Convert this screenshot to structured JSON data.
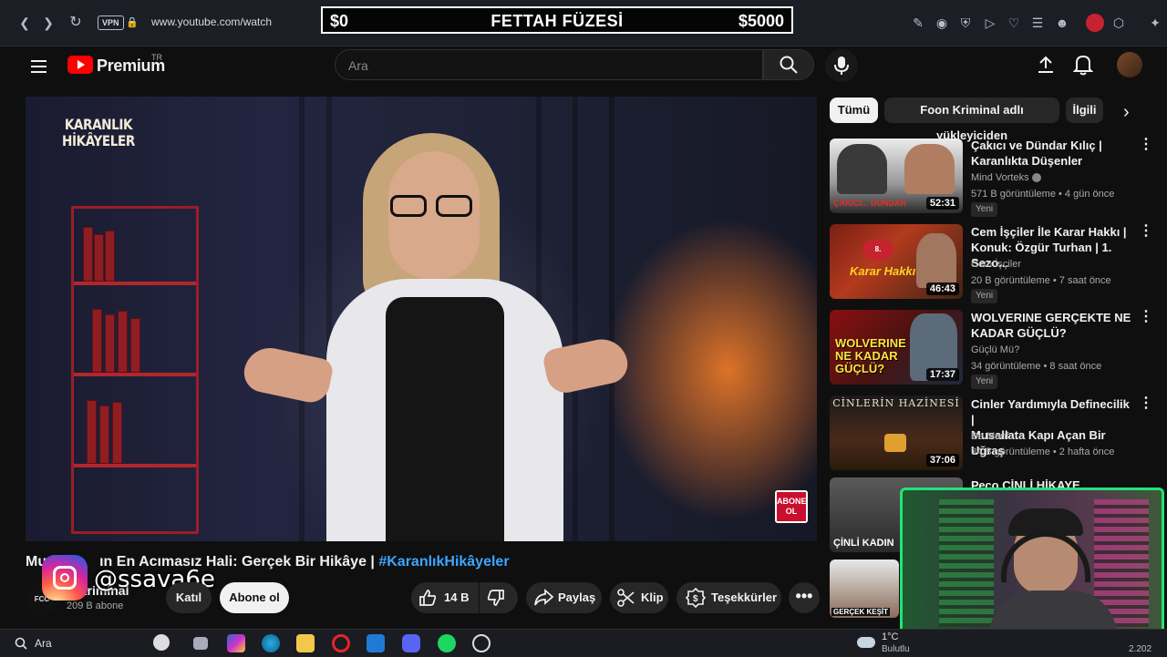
{
  "browser": {
    "url": "www.youtube.com/watch",
    "vpn_label": "VPN"
  },
  "donation_bar": {
    "left": "$0",
    "title": "FETTAH FÜZESİ",
    "right": "$5000"
  },
  "header": {
    "logo_text": "Premium",
    "region": "TR",
    "search_placeholder": "Ara"
  },
  "video": {
    "overlay_brand_line1": "KARANLIK",
    "overlay_brand_line2": "HİKÂYELER",
    "abone_badge_line1": "ABONE",
    "abone_badge_line2": "OL",
    "title_visible": "Mu",
    "title_rest": "ın En Acımasız Hali: Gerçek Bir Hikâye | ",
    "title_hashtag": "#KaranlıkHikâyeler"
  },
  "channel": {
    "logo_text": "FCC",
    "name": "n Kriminal",
    "subs": "209 B abone",
    "join_label": "Katıl",
    "subscribe_label": "Abone ol"
  },
  "actions": {
    "like_count": "14 B",
    "share_label": "Paylaş",
    "clip_label": "Klip",
    "thanks_label": "Teşekkürler"
  },
  "overlay": {
    "instagram_handle": "@ssava6e"
  },
  "chips": [
    "Tümü",
    "Foon Kriminal adlı yükleyiciden",
    "İlgili"
  ],
  "related": [
    {
      "title1": "Çakıcı ve Dündar Kılıç |",
      "title2": "Karanlıkta Düşenler",
      "channel": "Mind Vorteks",
      "meta": "571 B görüntüleme • 4 gün önce",
      "badge": "Yeni",
      "duration": "52:31",
      "thumb_caption": "ÇAKICI... DÜNDAR"
    },
    {
      "title1": "Cem İşçiler İle Karar Hakkı |",
      "title2": "Konuk: Özgür Turhan | 1. Sezo...",
      "channel": "Cem İşçiler",
      "meta": "20 B görüntüleme • 7 saat önce",
      "badge": "Yeni",
      "duration": "46:43",
      "thumb_caption": "Karar Hakkı"
    },
    {
      "title1": "WOLVERINE GERÇEKTE NE",
      "title2": "KADAR GÜÇLÜ?",
      "channel": "Güçlü Mü?",
      "meta": "34 görüntüleme • 8 saat önce",
      "badge": "Yeni",
      "duration": "17:37",
      "thumb_caption": "WOLVERINE NE KADAR GÜÇLÜ?"
    },
    {
      "title1": "Cinler Yardımıyla Definecilik |",
      "title2": "Musallata Kapı Açan Bir Uğraş",
      "channel": "De Monf.",
      "meta": "34 B görüntüleme • 2 hafta önce",
      "badge": "",
      "duration": "37:06",
      "thumb_caption": "CİNLERİN HAZİNESİ"
    },
    {
      "title1": "Ресо ÇİNLİ HİKAYE OKUYORU",
      "title2": "",
      "channel": "",
      "meta": "",
      "badge": "",
      "duration": "",
      "thumb_caption": "ÇİNLİ KADIN"
    },
    {
      "title1": "",
      "title2": "",
      "channel": "",
      "meta": "",
      "badge": "",
      "duration": "",
      "thumb_caption": "GERÇEK KEŞİT"
    }
  ],
  "taskbar": {
    "search_label": "Ara",
    "weather_temp": "1°C",
    "weather_text": "Bulutlu",
    "clock_fragment": "2.202"
  }
}
